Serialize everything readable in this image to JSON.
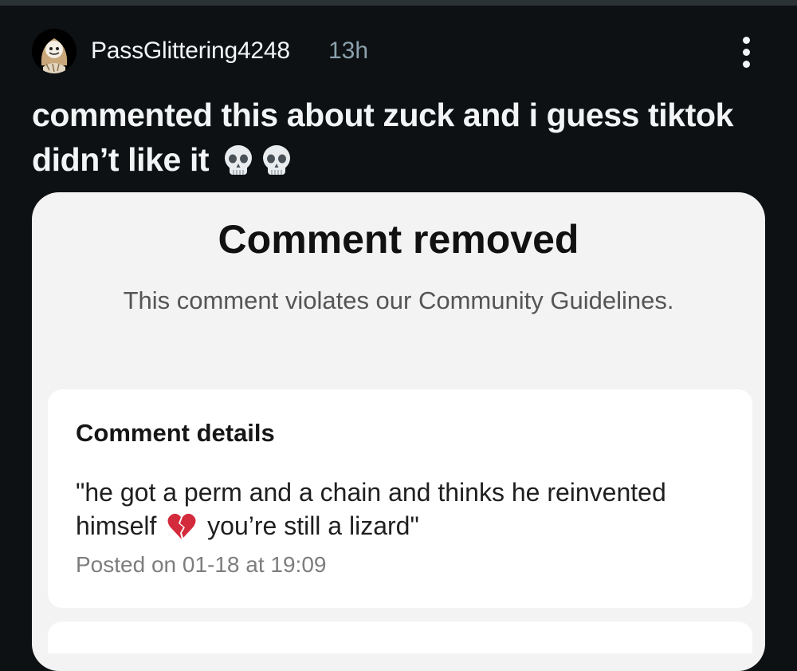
{
  "post": {
    "username": "PassGlittering4248",
    "age": "13h",
    "title": "commented this about zuck and i guess tiktok didn’t like it",
    "title_emoji": [
      "skull-emoji",
      "skull-emoji"
    ]
  },
  "card": {
    "title": "Comment removed",
    "subtitle": "This comment violates our Community Guidelines.",
    "details": {
      "heading": "Comment details",
      "quote_part1": "\"he got a perm and a chain and thinks he reinvented himself",
      "quote_emoji": "broken-heart-emoji",
      "quote_part2": "you’re still a lizard\"",
      "posted": "Posted on 01-18 at 19:09"
    }
  },
  "colors": {
    "background": "#0e1113",
    "meta_text": "#8ba2ad",
    "card_bg": "#f3f3f3",
    "broken_heart": "#d32a3c"
  }
}
